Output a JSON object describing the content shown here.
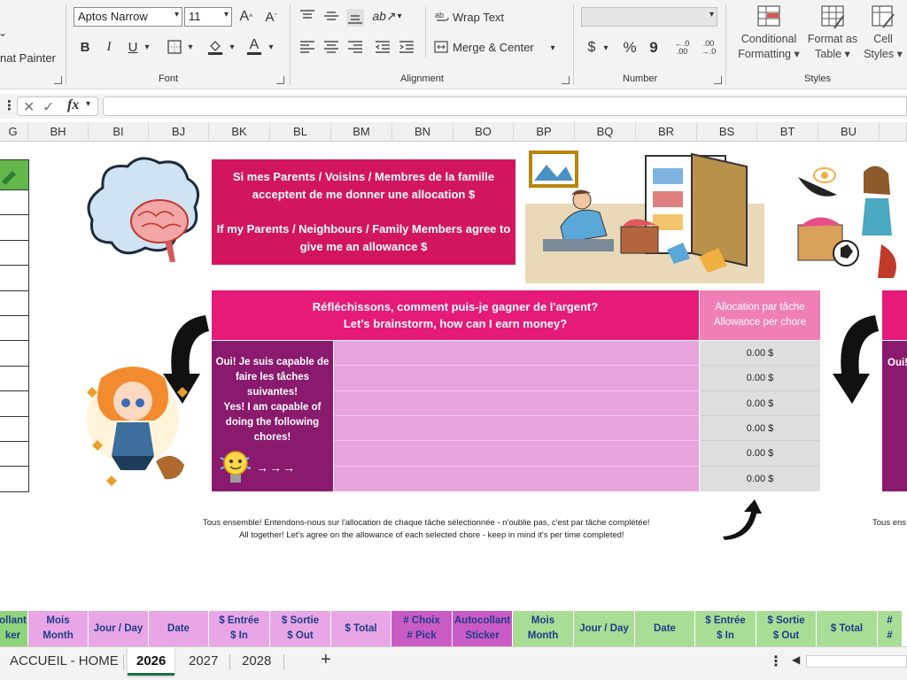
{
  "ribbon": {
    "clipboard": {
      "format_painter": "nat Painter"
    },
    "font": {
      "label": "Font",
      "font_name": "Aptos Narrow",
      "font_size": "11",
      "bold": "B",
      "italic": "I",
      "underline": "U"
    },
    "alignment": {
      "label": "Alignment",
      "wrap_text": "Wrap Text",
      "merge_center": "Merge & Center"
    },
    "number": {
      "label": "Number",
      "format_value": "",
      "currency": "$",
      "percent": "%",
      "comma": "9",
      "inc_decimal": "←.0 .00",
      "dec_decimal": ".00 →.0"
    },
    "styles": {
      "label": "Styles",
      "conditional_formatting": [
        "Conditional",
        "Formatting"
      ],
      "format_as_table": [
        "Format as",
        "Table"
      ],
      "cell_styles": [
        "Cell",
        "Styles"
      ]
    }
  },
  "formula_bar": {
    "fx": "fx",
    "value": ""
  },
  "columns": [
    "G",
    "BH",
    "BI",
    "BJ",
    "BK",
    "BL",
    "BM",
    "BN",
    "BO",
    "BP",
    "BQ",
    "BR",
    "BS",
    "BT",
    "BU"
  ],
  "sheet": {
    "parents_box": {
      "fr_line1": "Si mes Parents / Voisins / Membres de la famille",
      "fr_line2": "acceptent de me donner une allocation $",
      "en_line1": "If my Parents / Neighbours / Family Members agree to",
      "en_line2": "give me an allowance $"
    },
    "brainstorm": {
      "fr": "Réfléchissons, comment puis-je gagner de l'argent?",
      "en": "Let's brainstorm, how can I earn money?"
    },
    "allocation_header": {
      "fr": "Allocation par tâche",
      "en": "Allowance per chore"
    },
    "capable_box": {
      "lines": [
        "Oui! Je suis capable de",
        "faire les tâches",
        "suivantes!",
        "Yes! I am capable of",
        "doing the following",
        "chores!"
      ],
      "arrows": "→→→"
    },
    "allocations": [
      "0.00 $",
      "0.00 $",
      "0.00 $",
      "0.00 $",
      "0.00 $",
      "0.00 $"
    ],
    "notes": {
      "fr": "Tous ensemble! Entendons-nous sur l'allocation de chaque tâche sélectionnée - n'oublie pas, c'est par tâche complétée!",
      "en": "All together! Let's agree on the allowance of each selected chore - keep in mind it's per time completed!",
      "right_cut": "Tous ens",
      "right_cut_box": "Oui!"
    }
  },
  "bottom_headers": [
    {
      "lines": [
        "ollant",
        "ker"
      ],
      "bg": "#8ed47a"
    },
    {
      "lines": [
        "Mois",
        "Month"
      ],
      "bg": "#e8a6e6"
    },
    {
      "lines": [
        "Jour / Day"
      ],
      "bg": "#e8a6e6"
    },
    {
      "lines": [
        "Date"
      ],
      "bg": "#e8a6e6"
    },
    {
      "lines": [
        "$ Entrée",
        "$ In"
      ],
      "bg": "#e8a6e6"
    },
    {
      "lines": [
        "$ Sortie",
        "$ Out"
      ],
      "bg": "#e8a6e6"
    },
    {
      "lines": [
        "$ Total"
      ],
      "bg": "#e8a6e6"
    },
    {
      "lines": [
        "# Choix",
        "# Pick"
      ],
      "bg": "#c95bc5"
    },
    {
      "lines": [
        "Autocollant",
        "Sticker"
      ],
      "bg": "#c95bc5"
    },
    {
      "lines": [
        "Mois",
        "Month"
      ],
      "bg": "#a8dd96"
    },
    {
      "lines": [
        "Jour / Day"
      ],
      "bg": "#a8dd96"
    },
    {
      "lines": [
        "Date"
      ],
      "bg": "#a8dd96"
    },
    {
      "lines": [
        "$ Entrée",
        "$ In"
      ],
      "bg": "#a8dd96"
    },
    {
      "lines": [
        "$ Sortie",
        "$ Out"
      ],
      "bg": "#a8dd96"
    },
    {
      "lines": [
        "$ Total"
      ],
      "bg": "#a8dd96"
    },
    {
      "lines": [
        "#",
        "#"
      ],
      "bg": "#a8dd96"
    }
  ],
  "tabs": {
    "home": "ACCUEIL - HOME",
    "y2026": "2026",
    "y2027": "2027",
    "y2028": "2028",
    "add": "+"
  }
}
